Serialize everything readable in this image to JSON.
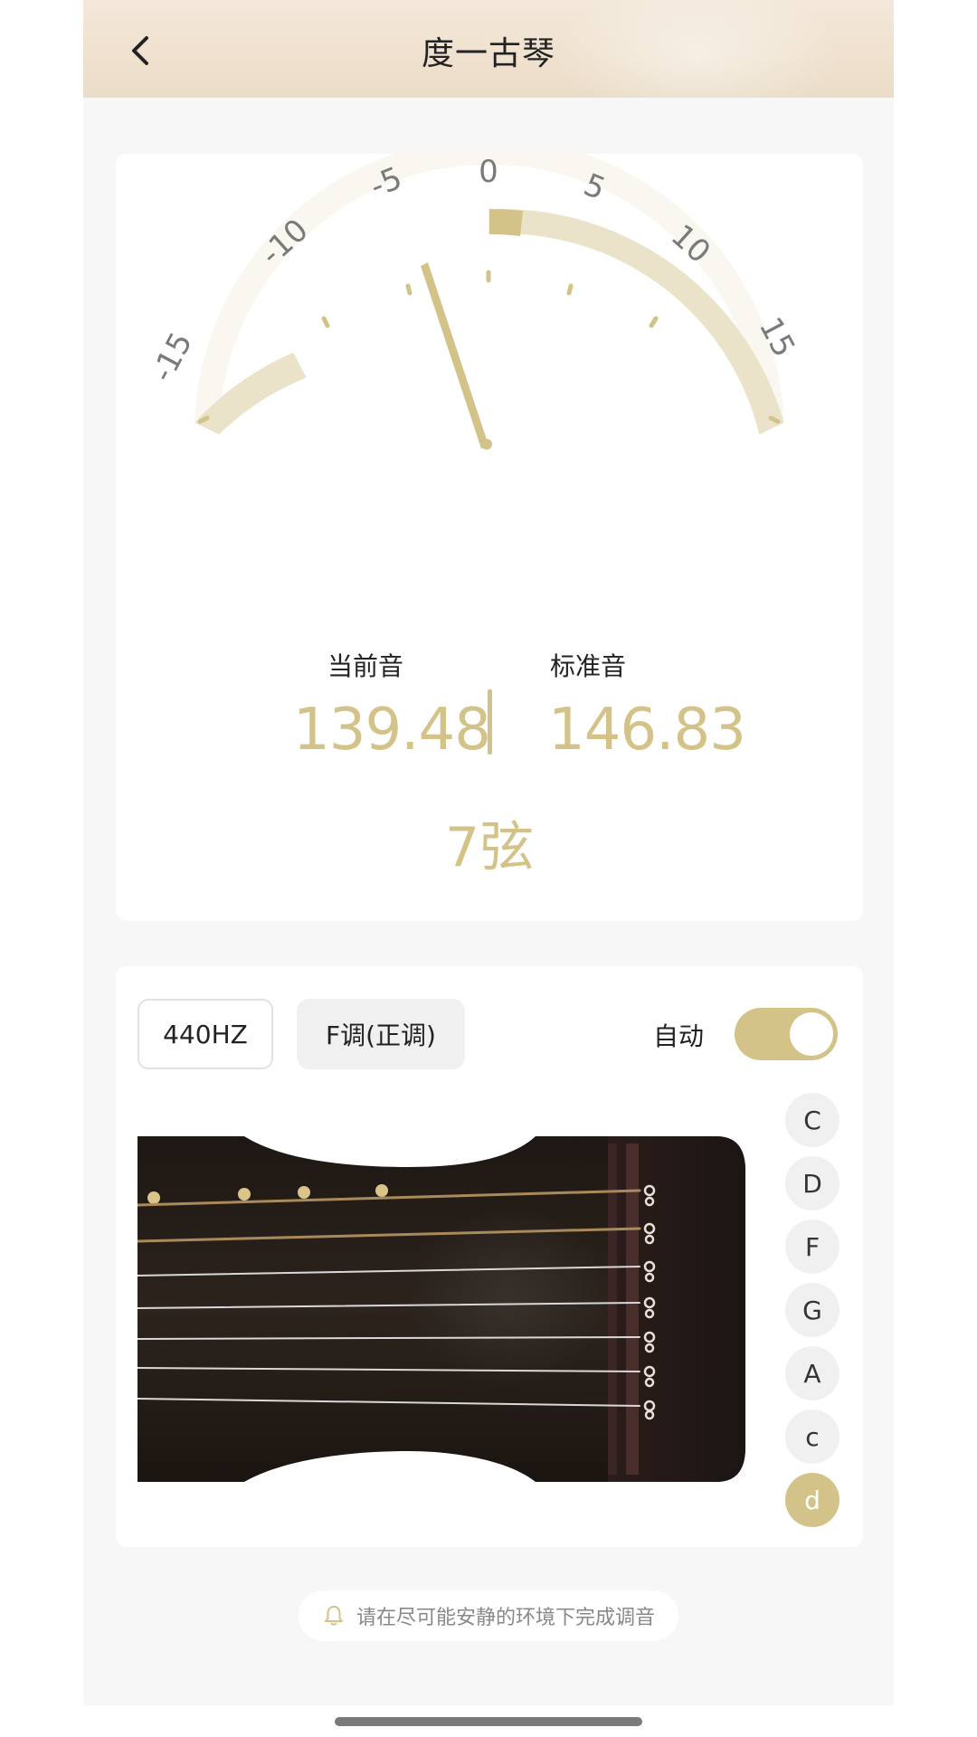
{
  "header": {
    "title": "度一古琴"
  },
  "gauge": {
    "ticks": [
      "-15",
      "-10",
      "-5",
      "0",
      "5",
      "10",
      "15"
    ],
    "cents_deviation": -5.0,
    "accent_color": "#d4c389",
    "band_color": "#ebe3c9"
  },
  "reading": {
    "current_label": "当前音",
    "standard_label": "标准音",
    "current_value": "139.48",
    "standard_value": "146.83",
    "string_name": "7弦"
  },
  "controls": {
    "reference_hz": "440HZ",
    "key": "F调(正调)",
    "auto_label": "自动",
    "auto_enabled": true
  },
  "notes": [
    "C",
    "D",
    "F",
    "G",
    "A",
    "c",
    "d"
  ],
  "active_note": "d",
  "tip": {
    "text": "请在尽可能安静的环境下完成调音",
    "icon": "bell-icon"
  }
}
